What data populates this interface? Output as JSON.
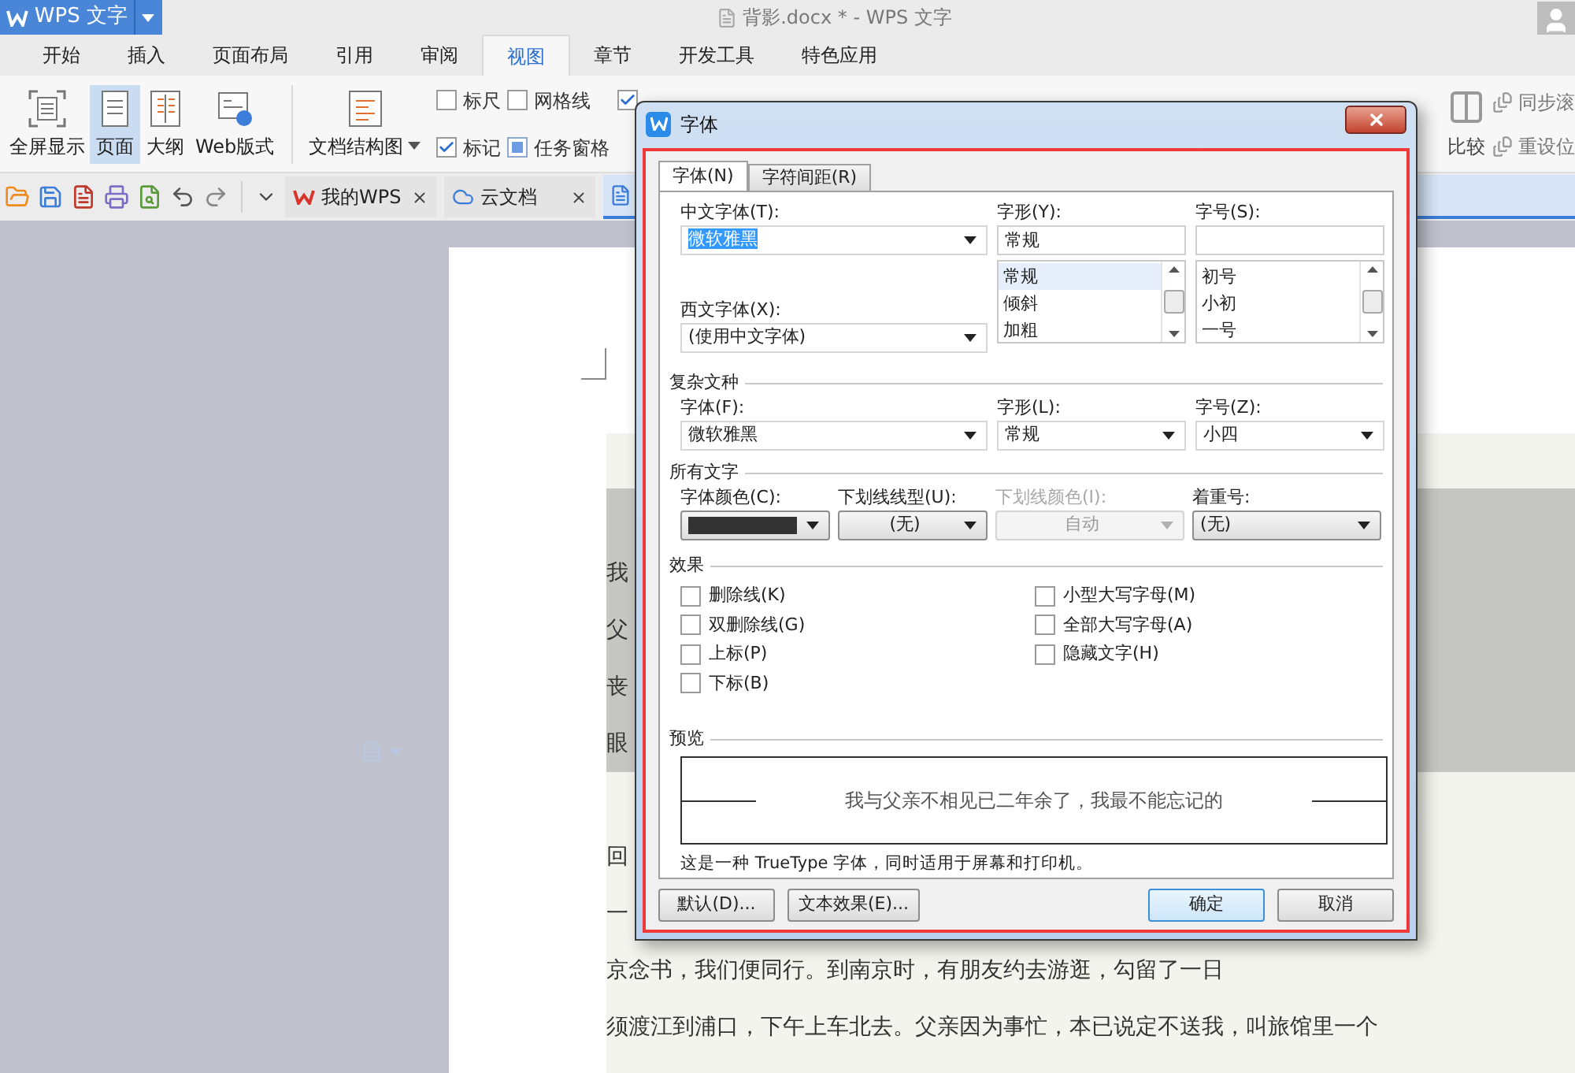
{
  "app_button": {
    "label": "WPS 文字"
  },
  "window": {
    "title": "背影.docx * - WPS 文字"
  },
  "menu_tabs": [
    {
      "label": "开始",
      "selected": false
    },
    {
      "label": "插入",
      "selected": false
    },
    {
      "label": "页面布局",
      "selected": false
    },
    {
      "label": "引用",
      "selected": false
    },
    {
      "label": "审阅",
      "selected": false
    },
    {
      "label": "视图",
      "selected": true
    },
    {
      "label": "章节",
      "selected": false
    },
    {
      "label": "开发工具",
      "selected": false
    },
    {
      "label": "特色应用",
      "selected": false
    }
  ],
  "ribbon": {
    "view_buttons": [
      {
        "label": "全屏显示",
        "selected": false
      },
      {
        "label": "页面",
        "selected": true
      },
      {
        "label": "大纲",
        "selected": false
      },
      {
        "label": "Web版式",
        "selected": false
      }
    ],
    "outline_button": {
      "label": "文档结构图"
    },
    "options": [
      {
        "kind": "tick",
        "label": "标尺",
        "checked": false
      },
      {
        "kind": "tick",
        "label": "网格线",
        "checked": false
      },
      {
        "kind": "tick",
        "checked": true
      },
      {
        "kind": "tick",
        "label": "标记",
        "checked": true
      },
      {
        "kind": "square",
        "label": "任务窗格",
        "checked": true
      }
    ],
    "compare_button": {
      "label": "比较"
    },
    "window_tools": [
      {
        "label": "同步滚"
      },
      {
        "label": "重设位"
      }
    ]
  },
  "doc_tabs": [
    {
      "label": "我的WPS",
      "selected": false
    },
    {
      "label": "云文档",
      "selected": false
    }
  ],
  "document": {
    "blocks": [
      {
        "highlighted": true,
        "lines": [
          "我",
          "父",
          "丧",
          "眼"
        ]
      },
      {
        "highlighted": false,
        "lines": [
          "回",
          "一",
          "京念书，我们便同行。到南京时，有朋友约去游逛，勾留了一日",
          "须渡江到浦口，下午上车北去。父亲因为事忙，本已说定不送我，叫旅馆里一个"
        ]
      }
    ]
  },
  "dialog": {
    "title": "字体",
    "tabs": [
      {
        "label": "字体(N)",
        "selected": true
      },
      {
        "label": "字符间距(R)",
        "selected": false
      }
    ],
    "chinese_font": {
      "label": "中文字体(T):",
      "value": "微软雅黑",
      "highlighted": true
    },
    "western_font": {
      "label": "西文字体(X):",
      "value": "(使用中文字体)",
      "highlighted": false
    },
    "style": {
      "label": "字形(Y):",
      "value": "常规",
      "options": [
        {
          "label": "常规",
          "selected": true
        },
        {
          "label": "倾斜",
          "selected": false
        },
        {
          "label": "加粗",
          "selected": false
        }
      ]
    },
    "size": {
      "label": "字号(S):",
      "options": [
        {
          "label": "初号",
          "selected": false
        },
        {
          "label": "小初",
          "selected": false
        },
        {
          "label": "一号",
          "selected": false
        }
      ]
    },
    "complex_section": {
      "title": "复杂文种",
      "fields": [
        {
          "label": "字体(F):",
          "value": "微软雅黑"
        },
        {
          "label": "字形(L):",
          "value": "常规"
        },
        {
          "label": "字号(Z):",
          "value": "小四"
        }
      ]
    },
    "all_text_section": {
      "title": "所有文字",
      "fields": [
        {
          "kind": "color",
          "label": "字体颜色(C):",
          "color": "#333333",
          "disabled": false
        },
        {
          "kind": "button",
          "label": "下划线线型(U):",
          "value": "(无)",
          "disabled": false
        },
        {
          "kind": "button",
          "label": "下划线颜色(I):",
          "value": "自动",
          "disabled": true
        },
        {
          "kind": "select",
          "label": "着重号:",
          "value": "(无)",
          "disabled": false
        }
      ]
    },
    "effects_section": {
      "title": "效果",
      "options": [
        {
          "label": "删除线(K)",
          "checked": false
        },
        {
          "label": "小型大写字母(M)",
          "checked": false
        },
        {
          "label": "双删除线(G)",
          "checked": false
        },
        {
          "label": "全部大写字母(A)",
          "checked": false
        },
        {
          "label": "上标(P)",
          "checked": false
        },
        {
          "label": "隐藏文字(H)",
          "checked": false
        },
        {
          "label": "下标(B)",
          "checked": false
        }
      ]
    },
    "preview": {
      "title": "预览",
      "sample": "我与父亲不相见已二年余了，我最不能忘记的",
      "note": "这是一种 TrueType 字体，同时适用于屏幕和打印机。"
    },
    "buttons_left": [
      {
        "label": "默认(D)...",
        "focused": false
      },
      {
        "label": "文本效果(E)...",
        "focused": false
      }
    ],
    "buttons_right": [
      {
        "label": "确定",
        "focused": true
      },
      {
        "label": "取消",
        "focused": false
      }
    ]
  }
}
